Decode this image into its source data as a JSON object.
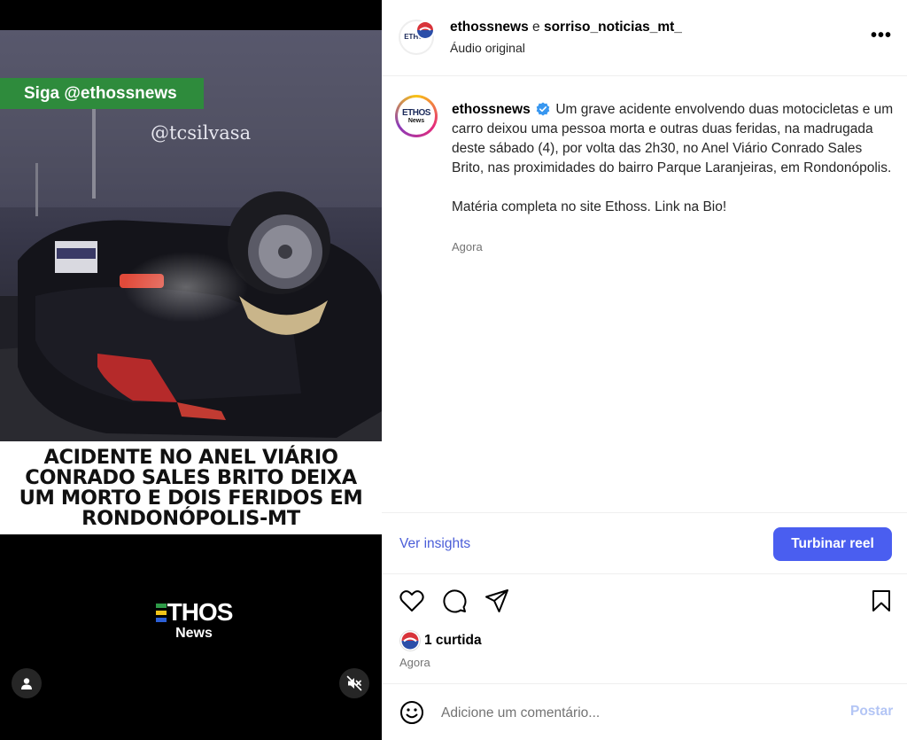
{
  "video": {
    "follow_banner": "Siga @ethossnews",
    "watermark": "@tcsilvasa",
    "headline": "ACIDENTE NO ANEL VIÁRIO CONRADO SALES BRITO DEIXA UM MORTO E DOIS FERIDOS EM RONDONÓPOLIS-MT",
    "logo_word": "THOS",
    "logo_sub": "News",
    "user_tag_icon": "person-icon",
    "mute_icon": "speaker-muted-icon"
  },
  "header": {
    "account_primary": "ethossnews",
    "conjunction": " e ",
    "account_collab": "sorriso_noticias_mt_",
    "audio": "Áudio original",
    "avatar_text": "ETHOS",
    "avatar_sub": "News",
    "more_label": "•••"
  },
  "caption": {
    "author": "ethossnews",
    "text": "Um grave acidente envolvendo duas motocicletas e um carro deixou uma pessoa morta e outras duas feridas, na madrugada deste sábado (4), por volta das 2h30, no Anel Viário Conrado Sales Brito, nas proximidades do bairro Parque Laranjeiras, em Rondonópolis.",
    "text_2": "Matéria completa no site Ethoss. Link na Bio!",
    "time": "Agora"
  },
  "insights": {
    "link": "Ver insights",
    "boost_button": "Turbinar reel"
  },
  "actions": {
    "icons": [
      "heart-icon",
      "comment-icon",
      "share-icon",
      "bookmark-icon"
    ],
    "likes": "1 curtida",
    "time": "Agora"
  },
  "comment": {
    "placeholder": "Adicione um comentário...",
    "post_button": "Postar"
  },
  "colors": {
    "accent": "#4a5ef0",
    "link": "#4a5dd8",
    "banner_green": "#2e8b3c",
    "verified": "#3897f0"
  }
}
